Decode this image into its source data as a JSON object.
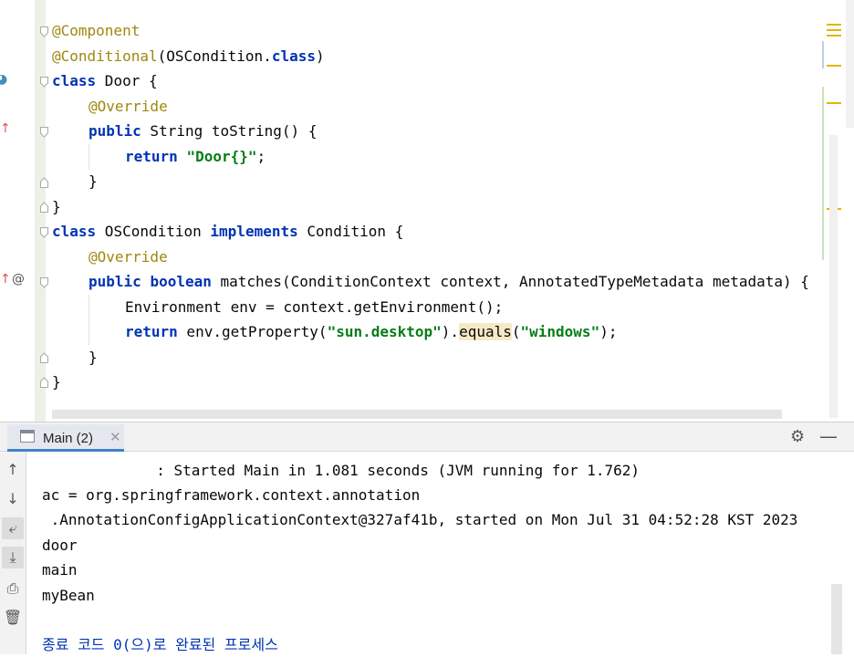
{
  "editor": {
    "lines": {
      "l1": "@Component",
      "l2_ann": "@Conditional",
      "l2_rest": "(OSCondition.",
      "l2_kw": "class",
      "l2_end": ")",
      "l3_kw": "class",
      "l3_rest": " Door {",
      "l4": "@Override",
      "l5_kw": "public",
      "l5_rest": " String toString() {",
      "l6_kw": "return",
      "l6_sp": " ",
      "l6_str": "\"Door{}\"",
      "l6_end": ";",
      "l7": "}",
      "l8": "}",
      "l9_kw": "class",
      "l9_mid": " OSCondition ",
      "l9_kw2": "implements",
      "l9_end": " Condition {",
      "l10": "@Override",
      "l11_kw": "public",
      "l11_sp": " ",
      "l11_kw2": "boolean",
      "l11_rest": " matches(ConditionContext context, AnnotatedTypeMetadata metadata) {",
      "l12": "Environment env = context.getEnvironment();",
      "l13_kw": "return",
      "l13_a": " env.getProperty(",
      "l13_str1": "\"sun.desktop\"",
      "l13_b": ").",
      "l13_hl": "equals",
      "l13_c": "(",
      "l13_str2": "\"windows\"",
      "l13_end": ");",
      "l14": "}",
      "l15": "}"
    },
    "gutter_icons": {
      "override_up_arrow": "↑",
      "at_sign": "@"
    }
  },
  "console": {
    "tab_label": "Main (2)",
    "tab_close": "✕",
    "lines": [
      "             : Started Main in 1.081 seconds (JVM running for 1.762)",
      "ac = org.springframework.context.annotation",
      " .AnnotationConfigApplicationContext@327af41b, started on Mon Jul 31 04:52:28 KST 2023",
      "door",
      "main",
      "myBean",
      "",
      "종료 코드 0(으)로 완료된 프로세스"
    ]
  },
  "colors": {
    "keyword": "#0033b3",
    "annotation": "#9e880d",
    "string": "#067d17",
    "process_exit": "#0033b3"
  }
}
